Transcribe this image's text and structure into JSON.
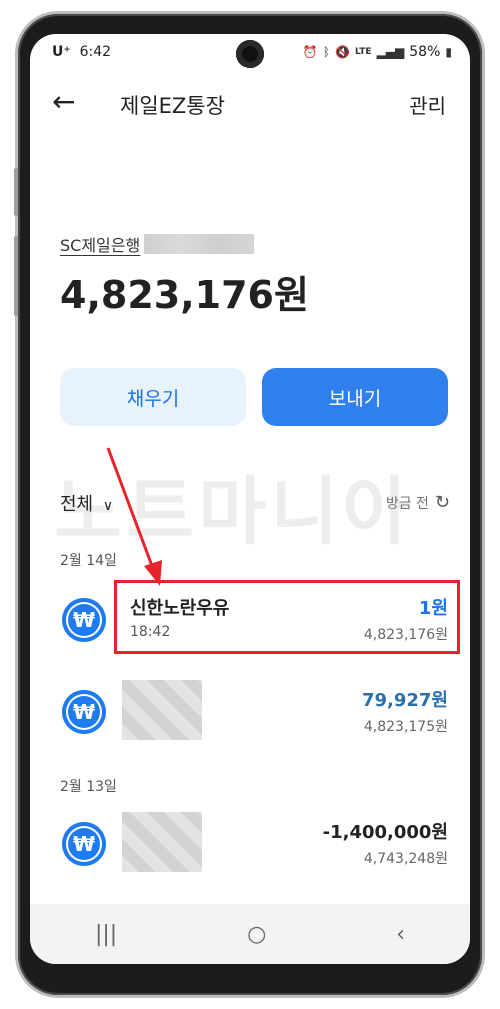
{
  "status_bar": {
    "carrier": "U⁺",
    "time": "6:42",
    "icons": [
      "alarm-icon",
      "bluetooth-icon",
      "mute-icon",
      "lte-icon",
      "signal-icon",
      "battery-icon"
    ],
    "battery": "58%"
  },
  "header": {
    "back_icon": "←",
    "title": "제일EZ통장",
    "manage_label": "관리"
  },
  "account": {
    "bank_name": "SC제일은행",
    "balance": "4,823,176원"
  },
  "actions": {
    "fill_label": "채우기",
    "send_label": "보내기"
  },
  "watermark": "노트마니아",
  "filter": {
    "label": "전체",
    "chevron": "∨",
    "refresh_label": "방금 전",
    "refresh_icon": "↻"
  },
  "groups": [
    {
      "date": "2월 14일",
      "transactions": [
        {
          "name": "신한노란우유",
          "time": "18:42",
          "amount": "1원",
          "balance": "4,823,176원",
          "amount_color": "#1a73e8"
        },
        {
          "name": "",
          "time": "",
          "amount": "79,927원",
          "balance": "4,823,175원",
          "amount_color": "#2a6fb0"
        }
      ]
    },
    {
      "date": "2월 13일",
      "transactions": [
        {
          "name": "",
          "time": "",
          "amount": "-1,400,000원",
          "balance": "4,743,248원",
          "amount_color": "#222222"
        }
      ]
    }
  ],
  "coin_symbol": "₩",
  "nav": {
    "recents": "|||",
    "home": "○",
    "back": "‹"
  },
  "colors": {
    "accent": "#2f80ed",
    "accent_light": "#e8f2fd",
    "highlight": "#e8232d"
  }
}
